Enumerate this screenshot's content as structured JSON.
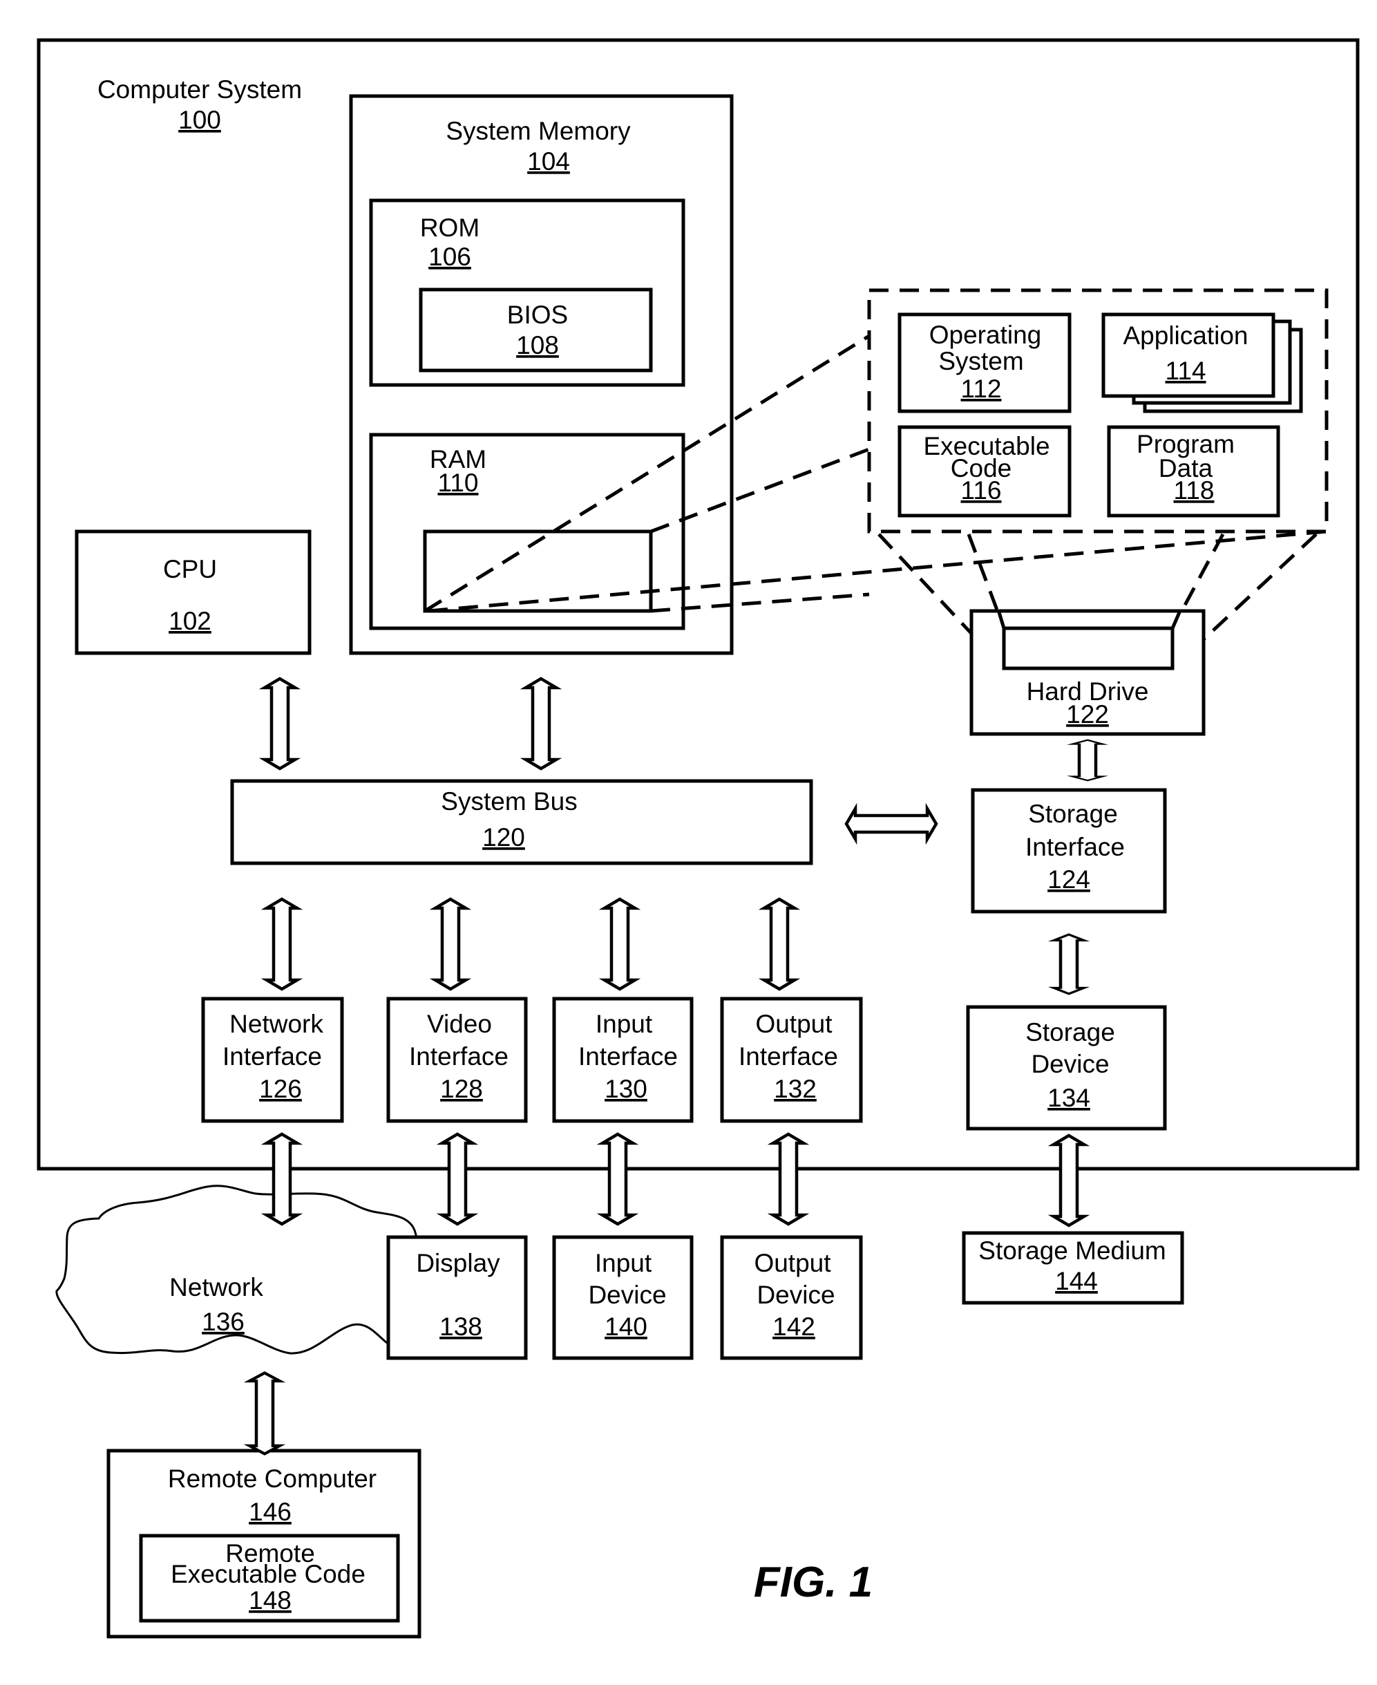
{
  "figure_label": "FIG. 1",
  "computer_system": {
    "label": "Computer System",
    "ref": "100"
  },
  "system_memory": {
    "label": "System Memory",
    "ref": "104"
  },
  "rom": {
    "label": "ROM",
    "ref": "106"
  },
  "bios": {
    "label": "BIOS",
    "ref": "108"
  },
  "ram": {
    "label": "RAM",
    "ref": "110"
  },
  "cpu": {
    "label": "CPU",
    "ref": "102"
  },
  "operating_system": {
    "line1": "Operating",
    "line2": "System",
    "ref": "112"
  },
  "application": {
    "label": "Application",
    "ref": "114"
  },
  "executable_code": {
    "line1": "Executable",
    "line2": "Code",
    "ref": "116"
  },
  "program_data": {
    "line1": "Program",
    "line2": "Data",
    "ref": "118"
  },
  "system_bus": {
    "label": "System Bus",
    "ref": "120"
  },
  "hard_drive": {
    "label": "Hard Drive",
    "ref": "122"
  },
  "storage_interface": {
    "line1": "Storage",
    "line2": "Interface",
    "ref": "124"
  },
  "network_interface": {
    "line1": "Network",
    "line2": "Interface",
    "ref": "126"
  },
  "video_interface": {
    "line1": "Video",
    "line2": "Interface",
    "ref": "128"
  },
  "input_interface": {
    "line1": "Input",
    "line2": "Interface",
    "ref": "130"
  },
  "output_interface": {
    "line1": "Output",
    "line2": "Interface",
    "ref": "132"
  },
  "storage_device": {
    "line1": "Storage",
    "line2": "Device",
    "ref": "134"
  },
  "network": {
    "label": "Network",
    "ref": "136"
  },
  "display": {
    "label": "Display",
    "ref": "138"
  },
  "input_device": {
    "line1": "Input",
    "line2": "Device",
    "ref": "140"
  },
  "output_device": {
    "line1": "Output",
    "line2": "Device",
    "ref": "142"
  },
  "storage_medium": {
    "label": "Storage Medium",
    "ref": "144"
  },
  "remote_computer": {
    "label": "Remote Computer",
    "ref": "146"
  },
  "remote_executable_code": {
    "line1": "Remote",
    "line2": "Executable Code",
    "ref": "148"
  }
}
